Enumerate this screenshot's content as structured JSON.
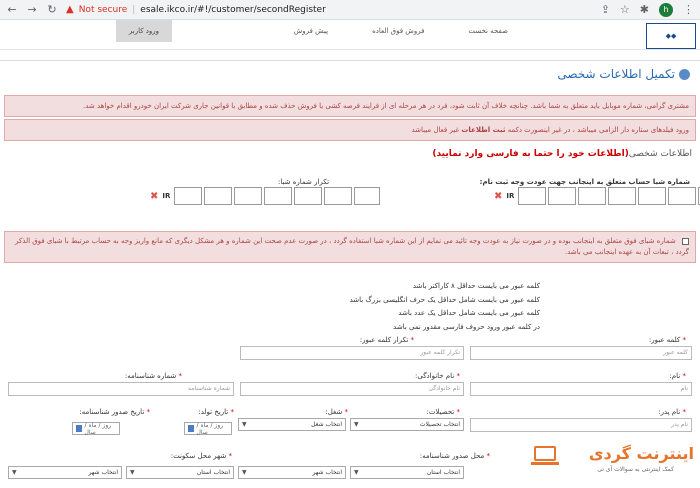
{
  "browser": {
    "security_label": "Not secure",
    "url": "esale.ikco.ir/#!/customer/secondRegister",
    "avatar_letter": "h"
  },
  "header": {
    "nav_items": [
      "صفحه نخست",
      "فروش فوق العاده",
      "پیش فروش"
    ],
    "login_label": "ورود کاربر"
  },
  "page": {
    "title": "تکمیل اطلاعات شخصی",
    "alert_mobile": "مشتری گرامی، شماره موبایل باید متعلق به شما باشد. چنانچه خلاف آن ثابت شود، فرد در هر مرحله ای از فرایند فرصه کشی یا فروش حذف شده و مطابق با قوانین جاری شرکت ایران خودرو اقدام خواهد شد.",
    "alert_required_pre": "ورود فیلدهای ستاره دار الزامی میباشد ، در غیر اینصورت دکمه",
    "alert_required_bold": "ثبت اطلاعات",
    "alert_required_post": "غیر فعال میباشد",
    "section_prefix": "اطلاعات شخصی",
    "section_highlight": "(اطلاعات خود را حتما به فارسی وارد نمایید)"
  },
  "sheba": {
    "label_main": "شماره شبا حساب متعلق به اینجانب جهت عودت وجه ثبت نام:",
    "label_repeat": "تکرار شماره شبا:",
    "prefix": "IR",
    "consent_text": "شماره شبای فوق متعلق به اینجانب بوده و در صورت نیاز به عودت وجه تائید می نمایم از این شماره شبا استفاده گردد ، در صورت عدم صحت این شماره و هر مشکل دیگری که مانع واریز وجه به حساب مرتبط با شبای فوق الذکر گردد ، تبعات آن به عهده اینجانب می باشد."
  },
  "password_rules": [
    "کلمه عبور می بایست حداقل ۸ کاراکتر باشد",
    "کلمه عبور می بایست شامل حداقل یک حرف انگلیسی بزرگ باشد",
    "کلمه عبور می بایست شامل حداقل یک عدد باشد",
    "در کلمه عبور ورود حروف فارسی مقدور نمی باشد"
  ],
  "fields": {
    "password": {
      "label": "کلمه عبور:",
      "placeholder": "کلمه عبور"
    },
    "password_repeat": {
      "label": "تکرار کلمه عبور:",
      "placeholder": "تکرار کلمه عبور"
    },
    "first_name": {
      "label": "نام:",
      "placeholder": "نام"
    },
    "last_name": {
      "label": "نام خانوادگی:",
      "placeholder": "نام خانوادگی"
    },
    "id_number": {
      "label": "شماره شناسنامه:",
      "placeholder": "شماره شناسنامه"
    },
    "father_name": {
      "label": "نام پدر:",
      "placeholder": "نام پدر"
    },
    "education": {
      "label": "تحصیلات:",
      "value": "انتخاب تحصیلات"
    },
    "job": {
      "label": "شغل:",
      "value": "انتخاب شغل"
    },
    "birth_date": {
      "label": "تاریخ تولد:",
      "value": "روز / ماه / سال"
    },
    "issue_date": {
      "label": "تاریخ صدور شناسنامه:",
      "value": "روز / ماه / سال"
    },
    "issue_place": {
      "label": "محل صدور شناسنامه:"
    },
    "issue_province": {
      "value": "انتخاب استان"
    },
    "issue_city": {
      "value": "انتخاب شهر"
    },
    "residence_city": {
      "label": "شهر محل سکونت:"
    },
    "res_province": {
      "value": "انتخاب استان"
    },
    "res_city": {
      "value": "انتخاب شهر"
    }
  },
  "watermark": {
    "brand": "اینترنت گردی",
    "tagline": "کمک اینترنتی به سوالات آی تی"
  }
}
